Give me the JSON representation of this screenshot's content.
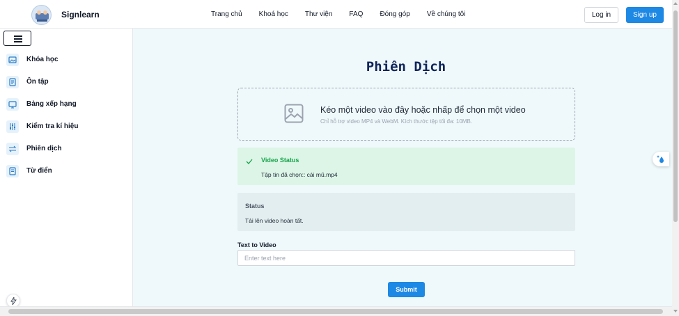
{
  "header": {
    "brand": "Signlearn",
    "logo_icon": "signlearn-logo",
    "nav": [
      "Trang chủ",
      "Khoá học",
      "Thư viện",
      "FAQ",
      "Đóng góp",
      "Về chúng tôi"
    ],
    "login_label": "Log in",
    "signup_label": "Sign up"
  },
  "sidebar": {
    "menu_icon": "hamburger-icon",
    "items": [
      {
        "label": "Khóa học",
        "icon": "image-icon"
      },
      {
        "label": "Ôn tập",
        "icon": "document-icon"
      },
      {
        "label": "Bảng xếp hạng",
        "icon": "monitor-icon"
      },
      {
        "label": "Kiểm tra kí hiệu",
        "icon": "sliders-icon"
      },
      {
        "label": "Phiên dịch",
        "icon": "arrows-icon"
      },
      {
        "label": "Từ điển",
        "icon": "book-icon"
      }
    ]
  },
  "main": {
    "title": "Phiên Dịch",
    "dropzone": {
      "icon": "image-icon",
      "text": "Kéo một video vào đây hoặc nhấp để chọn một video",
      "subtext": "Chỉ hỗ trợ video MP4 và WebM. Kích thước tệp tối đa: 10MB."
    },
    "video_status": {
      "title": "Video Status",
      "text": "Tập tin đã chọn:: cái mũ.mp4",
      "icon": "check-icon",
      "color": "#16a34a"
    },
    "status": {
      "title": "Status",
      "text": "Tải lên video hoàn tất."
    },
    "text_to_video": {
      "label": "Text to Video",
      "placeholder": "Enter text here",
      "value": ""
    },
    "submit_label": "Submit"
  },
  "colors": {
    "accent": "#1e88e5",
    "title": "#10245a",
    "main_bg": "#eff9fb",
    "success_bg": "#ddf5e7"
  }
}
